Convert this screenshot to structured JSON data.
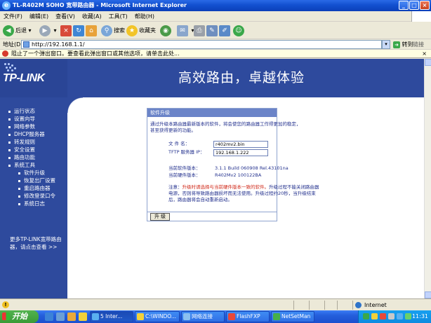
{
  "window": {
    "title": "TL-R402M SOHO 宽带路由器 - Microsoft Internet Explorer",
    "controls": [
      "_",
      "□",
      "×"
    ]
  },
  "menu": [
    "文件(F)",
    "编辑(E)",
    "查看(V)",
    "收藏(A)",
    "工具(T)",
    "帮助(H)"
  ],
  "toolbar": {
    "back": "后退",
    "search": "搜索",
    "favorites": "收藏夹"
  },
  "address": {
    "label": "地址(D)",
    "url": "http://192.168.1.1/",
    "go": "转到",
    "links": "链接"
  },
  "infobar": {
    "text": "阻止了一个弹出窗口。要查看此弹出窗口或其他选项，请单击此处..."
  },
  "banner": {
    "logo": "TP-LINK",
    "slogan": "高效路由，卓越体验"
  },
  "sidebar": {
    "items": [
      {
        "label": "运行状态",
        "sub": false
      },
      {
        "label": "设置向导",
        "sub": false
      },
      {
        "label": "网络参数",
        "sub": false
      },
      {
        "label": "DHCP服务器",
        "sub": false
      },
      {
        "label": "转发规则",
        "sub": false
      },
      {
        "label": "安全设置",
        "sub": false
      },
      {
        "label": "路由功能",
        "sub": false
      },
      {
        "label": "系统工具",
        "sub": false
      },
      {
        "label": "软件升级",
        "sub": true
      },
      {
        "label": "恢复出厂设置",
        "sub": true
      },
      {
        "label": "重启路由器",
        "sub": true
      },
      {
        "label": "修改登录口令",
        "sub": true
      },
      {
        "label": "系统日志",
        "sub": true
      }
    ],
    "more": "更多TP-LINK宽带路由器，请点击查看 >>"
  },
  "upgrade": {
    "header": "软件升级",
    "intro_line1": "通过升级本路由器最新版本的软件，将会使您的路由器工作得更加的稳定，",
    "intro_line2": "甚至获得更新的功能。",
    "filename_label": "文 件 名：",
    "filename_value": "r402mv2.bin",
    "tftp_label": "TFTP 服务器 IP：",
    "tftp_value": "192.168.1.222",
    "sw_label": "当前软件版本：",
    "sw_value": "3.1.1 Build 060908 Rel.43101na",
    "hw_label": "当前硬件版本：",
    "hw_value": "R402Mv2 100122BA",
    "note_prefix": "注意：",
    "note_warn": "升级时请选择与当前硬件版本一致的软件。",
    "note_rest1": "升级过程不能关闭路由器",
    "note_line2": "电源，否则将导致路由器损坏而无法使用。升级过程约20秒，当升级结束",
    "note_line3": "后，路由器将会自动重新启动。",
    "button": "升 级"
  },
  "status": {
    "zone": "Internet"
  },
  "taskbar": {
    "start": "开始",
    "tasks": [
      "5 Inter...",
      "C:\\WINDO...",
      "网络连接",
      "FlashFXP",
      "NetSetMan"
    ],
    "clock": "11:31"
  }
}
